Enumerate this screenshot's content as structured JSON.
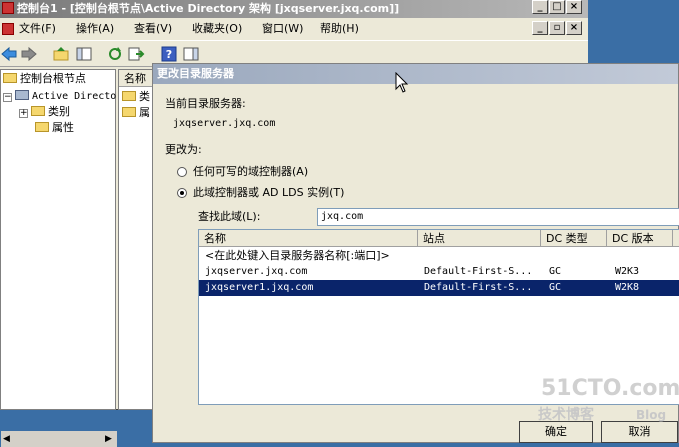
{
  "mmc": {
    "title": "控制台1 - [控制台根节点\\Active Directory 架构 [jxqserver.jxq.com]]",
    "menu": [
      "文件(F)",
      "操作(A)",
      "查看(V)",
      "收藏夹(O)",
      "窗口(W)",
      "帮助(H)"
    ],
    "tree": {
      "root": "控制台根节点",
      "ad_node": "Active Directo",
      "classes": "类别",
      "attributes": "属性"
    },
    "list": {
      "header": "名称",
      "items": [
        "类",
        "属"
      ]
    }
  },
  "dialog": {
    "title": "更改目录服务器",
    "current_label": "当前目录服务器:",
    "current_value": "jxqserver.jxq.com",
    "change_to_label": "更改为:",
    "option_any": "任何可写的域控制器(A)",
    "option_this": "此域控制器或 AD LDS 实例(T)",
    "selected_option": "this",
    "find_in_label": "查找此域(L):",
    "find_in_value": "jxq.com",
    "columns": [
      "名称",
      "站点",
      "DC 类型",
      "DC 版本"
    ],
    "placeholder_row": "<在此处键入目录服务器名称[:端口]>",
    "rows": [
      {
        "name": "jxqserver.jxq.com",
        "site": "Default-First-S...",
        "type": "GC",
        "version": "W2K3",
        "selected": false
      },
      {
        "name": "jxqserver1.jxq.com",
        "site": "Default-First-S...",
        "type": "GC",
        "version": "W2K8",
        "selected": true
      }
    ],
    "ok_label": "确定",
    "cancel_label": "取消"
  },
  "watermark": {
    "line1": "51CTO.com",
    "line2": "技术博客",
    "line3": "Blog"
  }
}
